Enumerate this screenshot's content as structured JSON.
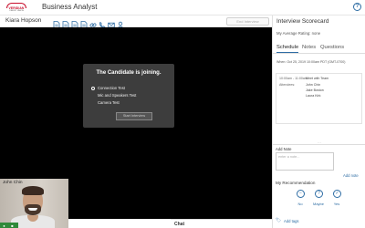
{
  "header": {
    "logo_text": "VERIDIAN",
    "logo_sub": "CREDIT UNION",
    "job_title": "Business Analyst",
    "help_icon": "question-circle-icon"
  },
  "candidate_bar": {
    "name": "Kiara Hopson",
    "tools": [
      "document-icon",
      "document-icon",
      "document-icon",
      "document-icon",
      "link-icon",
      "phone-icon",
      "email-icon",
      "user-icon"
    ],
    "end_button": "End Interview"
  },
  "stage": {
    "join_title": "The Candidate is joining.",
    "tests": [
      "Connection Test",
      "Mic and Speakers Test",
      "Camera Test"
    ],
    "start_button": "Start Interview"
  },
  "self_view": {
    "name": "John Chin",
    "controls": [
      "mic-icon",
      "camera-icon"
    ]
  },
  "chat": {
    "label": "Chat"
  },
  "scorecard": {
    "title": "Interview Scorecard",
    "average_rating": "My Average Rating: none",
    "tabs": [
      "Schedule",
      "Notes",
      "Questions"
    ],
    "active_tab": "Schedule",
    "when": "When: Oct 25, 2019 10:00am PDT (GMT-0700)",
    "meeting": {
      "time": "10:00am - 11:00am",
      "title": "Meet with Team",
      "attendees_label": "Attendees:",
      "attendees": [
        "John Chin",
        "Jake Boston",
        "Laura Kirk"
      ]
    },
    "add_note_label": "Add Note",
    "note_placeholder": "enter a note...",
    "add_note_link": "Add note",
    "recommendation_label": "My Recommendation",
    "recommendation_options": [
      {
        "label": "No",
        "icon": "no-icon"
      },
      {
        "label": "Maybe",
        "icon": "question-icon"
      },
      {
        "label": "Yes",
        "icon": "check-icon"
      }
    ],
    "add_tags": "Add tags"
  },
  "colors": {
    "accent": "#2e6da4",
    "brand": "#c8102e",
    "stage_bg": "#000000",
    "modal_bg": "#3d3d3d",
    "controls_green": "#2f8a3a"
  }
}
